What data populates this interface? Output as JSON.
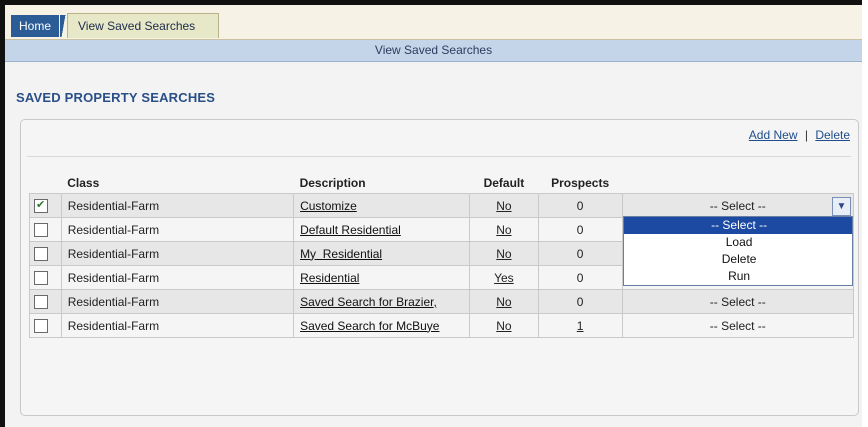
{
  "tabs": {
    "home": "Home",
    "active": "View Saved Searches"
  },
  "subheader": "View Saved Searches",
  "section_title": "SAVED PROPERTY SEARCHES",
  "actions": {
    "add_new": "Add New",
    "separator": "|",
    "delete": "Delete"
  },
  "columns": {
    "class": "Class",
    "description": "Description",
    "default": "Default",
    "prospects": "Prospects"
  },
  "rows": [
    {
      "checked": true,
      "class": "Residential-Farm",
      "description": "Customize",
      "default": "No",
      "prospects": "0",
      "select": "-- Select --"
    },
    {
      "checked": false,
      "class": "Residential-Farm",
      "description": "Default Residential",
      "default": "No",
      "prospects": "0",
      "select": ""
    },
    {
      "checked": false,
      "class": "Residential-Farm",
      "description": "My  Residential",
      "default": "No",
      "prospects": "0",
      "select": ""
    },
    {
      "checked": false,
      "class": "Residential-Farm",
      "description": "Residential",
      "default": "Yes",
      "prospects": "0",
      "select": ""
    },
    {
      "checked": false,
      "class": "Residential-Farm",
      "description": "Saved Search for Brazier,",
      "default": "No",
      "prospects": "0",
      "select": "-- Select --"
    },
    {
      "checked": false,
      "class": "Residential-Farm",
      "description": "Saved Search for McBuye",
      "default": "No",
      "prospects": "1",
      "select": "-- Select --"
    }
  ],
  "dropdown": {
    "options": [
      "-- Select --",
      "Load",
      "Delete",
      "Run"
    ],
    "highlighted_index": 0
  },
  "colors": {
    "tab_blue": "#2b5c95",
    "subbar": "#c4d5ea",
    "highlight": "#1c4aa3"
  }
}
